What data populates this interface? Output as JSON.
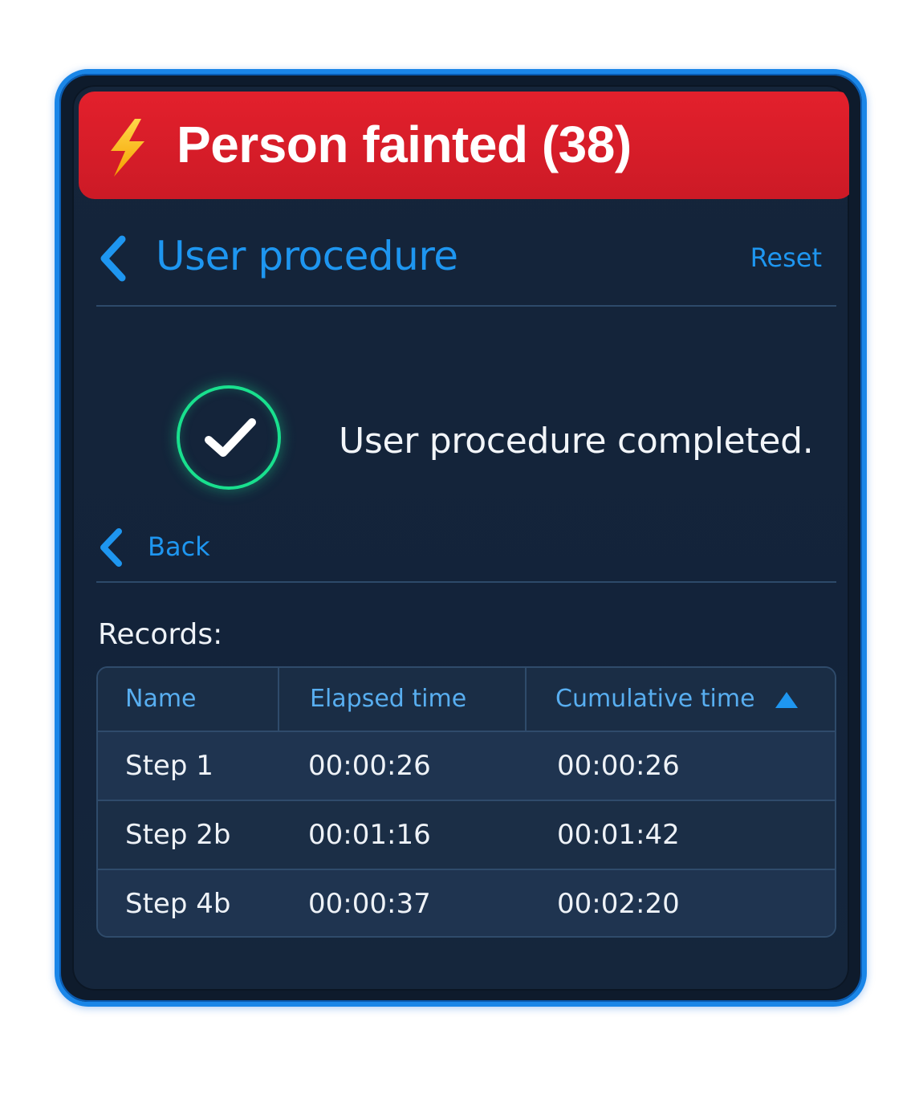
{
  "alert": {
    "icon": "lightning-bolt-icon",
    "title": "Person fainted (38)",
    "color": "#e3202c"
  },
  "header": {
    "back_icon": "chevron-left-icon",
    "title": "User procedure",
    "reset_label": "Reset"
  },
  "status": {
    "icon": "check-circle-icon",
    "message": "User procedure completed.",
    "color": "#19e08e"
  },
  "back": {
    "icon": "chevron-left-icon",
    "label": "Back"
  },
  "records": {
    "label": "Records:",
    "columns": [
      "Name",
      "Elapsed time",
      "Cumulative time"
    ],
    "sort": {
      "column": "Cumulative time",
      "direction": "ascending",
      "icon": "triangle-up-icon"
    },
    "rows": [
      {
        "name": "Step 1",
        "elapsed": "00:00:26",
        "cumulative": "00:00:26"
      },
      {
        "name": "Step 2b",
        "elapsed": "00:01:16",
        "cumulative": "00:01:42"
      },
      {
        "name": "Step 4b",
        "elapsed": "00:00:37",
        "cumulative": "00:02:20"
      }
    ]
  },
  "theme": {
    "accent": "#1e96f0",
    "background": "#13233a",
    "frame": "#1a86e8"
  }
}
